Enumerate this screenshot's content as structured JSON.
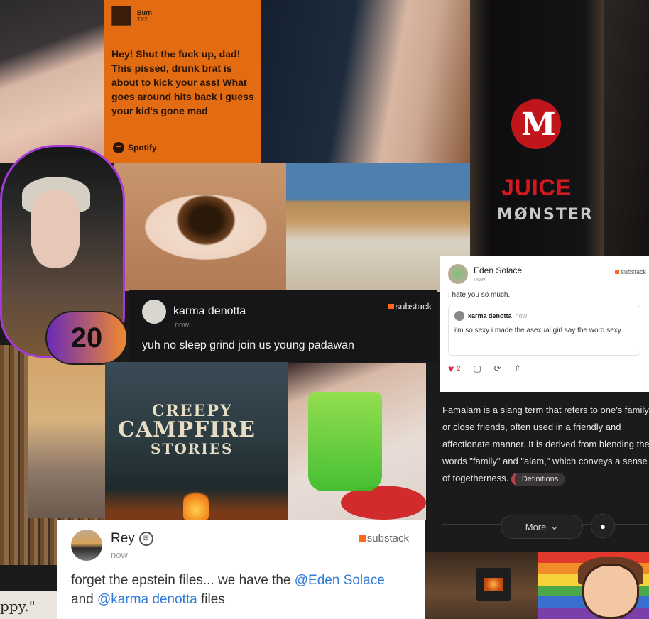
{
  "spotify": {
    "track": "Burn",
    "artist": "TX2",
    "lyrics": "Hey! Shut the fuck up, dad! This pissed, drunk brat is about to kick your ass! What goes around hits back I guess your kid's gone mad",
    "brand": "Spotify",
    "bg_color": "#e36b12"
  },
  "can": {
    "line1": "JUICE",
    "line2": "MØNSTER"
  },
  "portrait_badge": "20",
  "karma_post": {
    "author": "karma denotta",
    "time": "now",
    "body": "yuh no sleep grind join us young padawan",
    "source": "substack"
  },
  "eden_post": {
    "author": "Eden Solace",
    "time": "now",
    "source": "substack",
    "body": "I hate you so much.",
    "quote": {
      "author": "karma denotta",
      "time": "now",
      "body": "i'm so sexy i made the asexual girl say the word sexy"
    },
    "likes": "2"
  },
  "famalam": {
    "text": "Famalam is a slang term that refers to one's family or close friends, often used in a friendly and affectionate manner. It is derived from blending the words \"family\" and \"alam,\" which conveys a sense of togetherness.",
    "chip": "Definitions",
    "more_label": "More"
  },
  "book": {
    "line1": "CREEPY",
    "line2": "CAMPFIRE",
    "line3": "STORIES"
  },
  "rey_post": {
    "author": "Rey",
    "time": "now",
    "source": "substack",
    "body_part1": "forget the epstein files... we have the ",
    "mention1": "@Eden Solace",
    "body_part2": " and ",
    "mention2": "@karma denotta",
    "body_part3": " files"
  },
  "corner_text": "ppy.\"",
  "colors": {
    "substack_orange": "#ff6719",
    "mention_blue": "#2f7bd8",
    "heart_red": "#e0233f"
  }
}
